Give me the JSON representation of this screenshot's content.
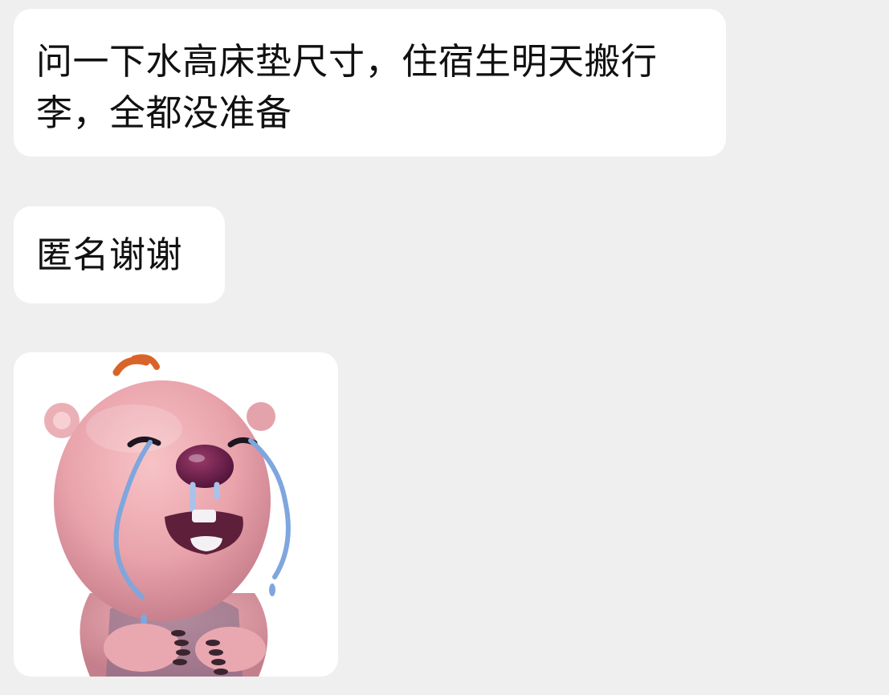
{
  "conversation": {
    "messages": [
      {
        "type": "text",
        "text": "问一下水高床垫尺寸，住宿生明天搬行李，全都没准备"
      },
      {
        "type": "text",
        "text": "匿名谢谢"
      },
      {
        "type": "sticker",
        "sticker": "crying-pink-beaver-sticker"
      }
    ]
  },
  "colors": {
    "background": "#efefef",
    "bubble": "#ffffff",
    "text": "#111111"
  }
}
